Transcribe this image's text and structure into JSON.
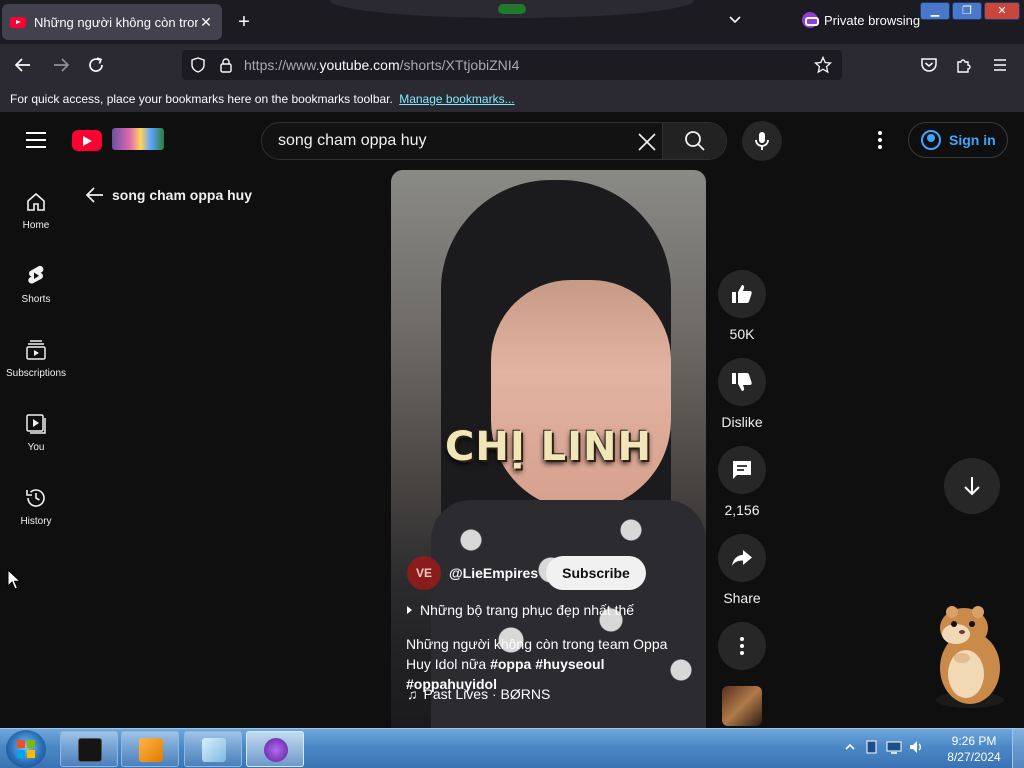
{
  "browser": {
    "tab_title": "Những người không còn trong",
    "tab_close": "✕",
    "new_tab": "+",
    "private_label": "Private browsing",
    "url_prefix": "https://www.",
    "url_domain": "youtube.com",
    "url_path": "/shorts/XTtjobiZNI4",
    "bookmarks_text": "For quick access, place your bookmarks here on the bookmarks toolbar.",
    "bookmarks_link": "Manage bookmarks..."
  },
  "youtube": {
    "search_query": "song cham oppa huy",
    "sign_in": "Sign in",
    "back_label": "song cham oppa huy",
    "sidebar": [
      {
        "label": "Home",
        "icon": "home-icon"
      },
      {
        "label": "Shorts",
        "icon": "shorts-icon"
      },
      {
        "label": "Subscriptions",
        "icon": "subscriptions-icon"
      },
      {
        "label": "You",
        "icon": "you-icon"
      },
      {
        "label": "History",
        "icon": "history-icon"
      }
    ],
    "video": {
      "overlay_text": "CHỊ LINH",
      "channel_avatar_text": "VE",
      "channel": "@LieEmpires",
      "subscribe": "Subscribe",
      "playlist": "Những bộ trang phục đẹp nhất thế",
      "description_text": "Những người không còn trong team Oppa Huy Idol nữa ",
      "hashtags": "#oppa #huyseoul #oppahuyidol",
      "music": "Past Lives · BØRNS"
    },
    "actions": {
      "likes": "50K",
      "dislike": "Dislike",
      "comments": "2,156",
      "share": "Share"
    }
  },
  "taskbar": {
    "time": "9:26 PM",
    "date": "8/27/2024"
  },
  "colors": {
    "accent_blue": "#3ea6ff",
    "youtube_red": "#ff0033",
    "background": "#0f0f0f"
  }
}
